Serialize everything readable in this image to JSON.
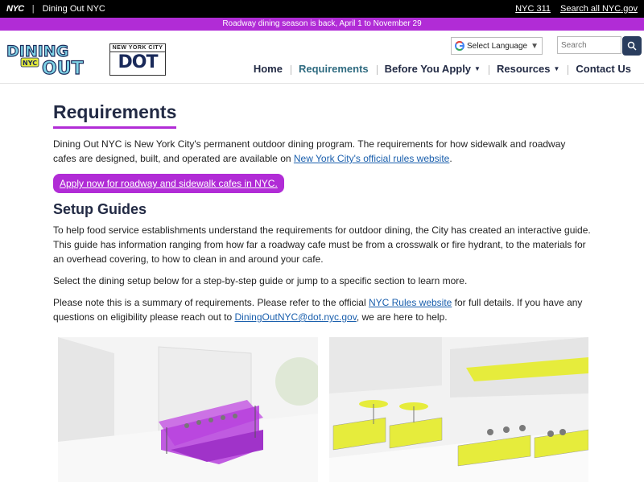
{
  "topbar": {
    "nyc": "NYC",
    "site": "Dining Out NYC",
    "links": [
      "NYC 311",
      "Search all NYC.gov"
    ]
  },
  "banner": "Roadway dining season is back, April 1 to November 29",
  "logos": {
    "dining_line1": "DINING",
    "dining_nyc": "NYC",
    "dining_line2": "OUT",
    "dot_top": "NEW YORK CITY",
    "dot_main": "DOT"
  },
  "language": {
    "label": "Select Language",
    "icon": "google-icon"
  },
  "search": {
    "placeholder": "Search",
    "icon": "search-icon"
  },
  "nav": {
    "home": "Home",
    "requirements": "Requirements",
    "before": "Before You Apply",
    "resources": "Resources",
    "contact": "Contact Us"
  },
  "page": {
    "title": "Requirements",
    "intro": "Dining Out NYC is New York City's permanent outdoor dining program. The requirements for how sidewalk and roadway cafes are designed, built, and operated are available on ",
    "intro_link": "New York City's official rules website",
    "intro_end": ".",
    "cta": "Apply now for roadway and sidewalk cafes in NYC.",
    "setup_title": "Setup Guides",
    "setup_p1": "To help food service establishments understand the requirements for outdoor dining, the City has created an interactive guide. This guide has information ranging from how far a roadway cafe must be from a crosswalk or fire hydrant, to the materials for an overhead covering, to how to clean in and around your cafe.",
    "setup_p2": "Select the dining setup below for a step-by-step guide or jump to a specific section to learn more.",
    "note_pre": "Please note this is a summary of requirements. Please refer to the official ",
    "note_link": "NYC Rules website",
    "note_mid": " for full details. If you have any questions on eligibility please reach out to ",
    "note_email": "DiningOutNYC@dot.nyc.gov",
    "note_end": ", we are here to help."
  },
  "colors": {
    "accent": "#b12cd6",
    "navy": "#222a44",
    "link": "#1a5fad",
    "yellow": "#e6ec3c"
  }
}
